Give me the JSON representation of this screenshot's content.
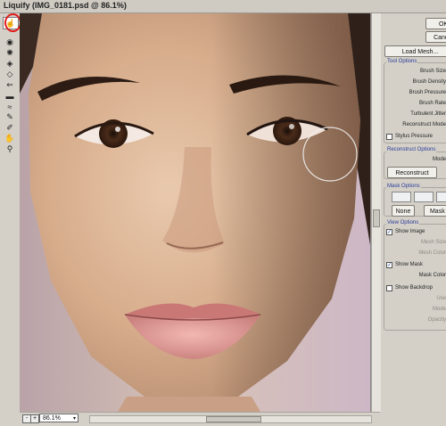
{
  "window": {
    "title": "Liquify (IMG_0181.psd @ 86.1%)"
  },
  "tools": [
    {
      "icon": "forward-warp-icon"
    },
    {
      "icon": "reconstruct-icon"
    },
    {
      "icon": "twirl-icon"
    },
    {
      "icon": "pucker-icon"
    },
    {
      "icon": "bloat-icon"
    },
    {
      "icon": "push-left-icon"
    },
    {
      "icon": "mirror-icon"
    },
    {
      "icon": "turbulence-icon"
    },
    {
      "icon": "freeze-mask-icon"
    },
    {
      "icon": "thaw-mask-icon"
    },
    {
      "icon": "hand-icon"
    },
    {
      "icon": "zoom-icon"
    }
  ],
  "annotation": {
    "color": "#e01a1a"
  },
  "buttons": {
    "ok": "OK",
    "cancel": "Cancel",
    "load_mesh": "Load Mesh...",
    "reconstruct": "Reconstruct",
    "none": "None",
    "mask_all": "Mask All"
  },
  "tool_options": {
    "title": "Tool Options",
    "brush_size": "Brush Size",
    "brush_density": "Brush Density",
    "brush_pressure": "Brush Pressure",
    "brush_rate": "Brush Rate",
    "turbulent_jitter": "Turbulent Jitter",
    "reconstruct_mode": "Reconstruct Mode",
    "stylus_pressure": "Stylus Pressure"
  },
  "reconstruct_options": {
    "title": "Reconstruct Options",
    "mode": "Mode"
  },
  "mask_options": {
    "title": "Mask Options"
  },
  "view_options": {
    "title": "View Options",
    "show_image": "Show Image",
    "mesh_size": "Mesh Size",
    "mesh_color": "Mesh Color",
    "show_mask": "Show Mask",
    "mask_color": "Mask Color",
    "show_backdrop": "Show Backdrop",
    "use": "Use",
    "mode": "Mode",
    "opacity": "Opacity"
  },
  "status": {
    "zoom": "86.1%",
    "zoom_out": "-",
    "zoom_in": "+"
  }
}
